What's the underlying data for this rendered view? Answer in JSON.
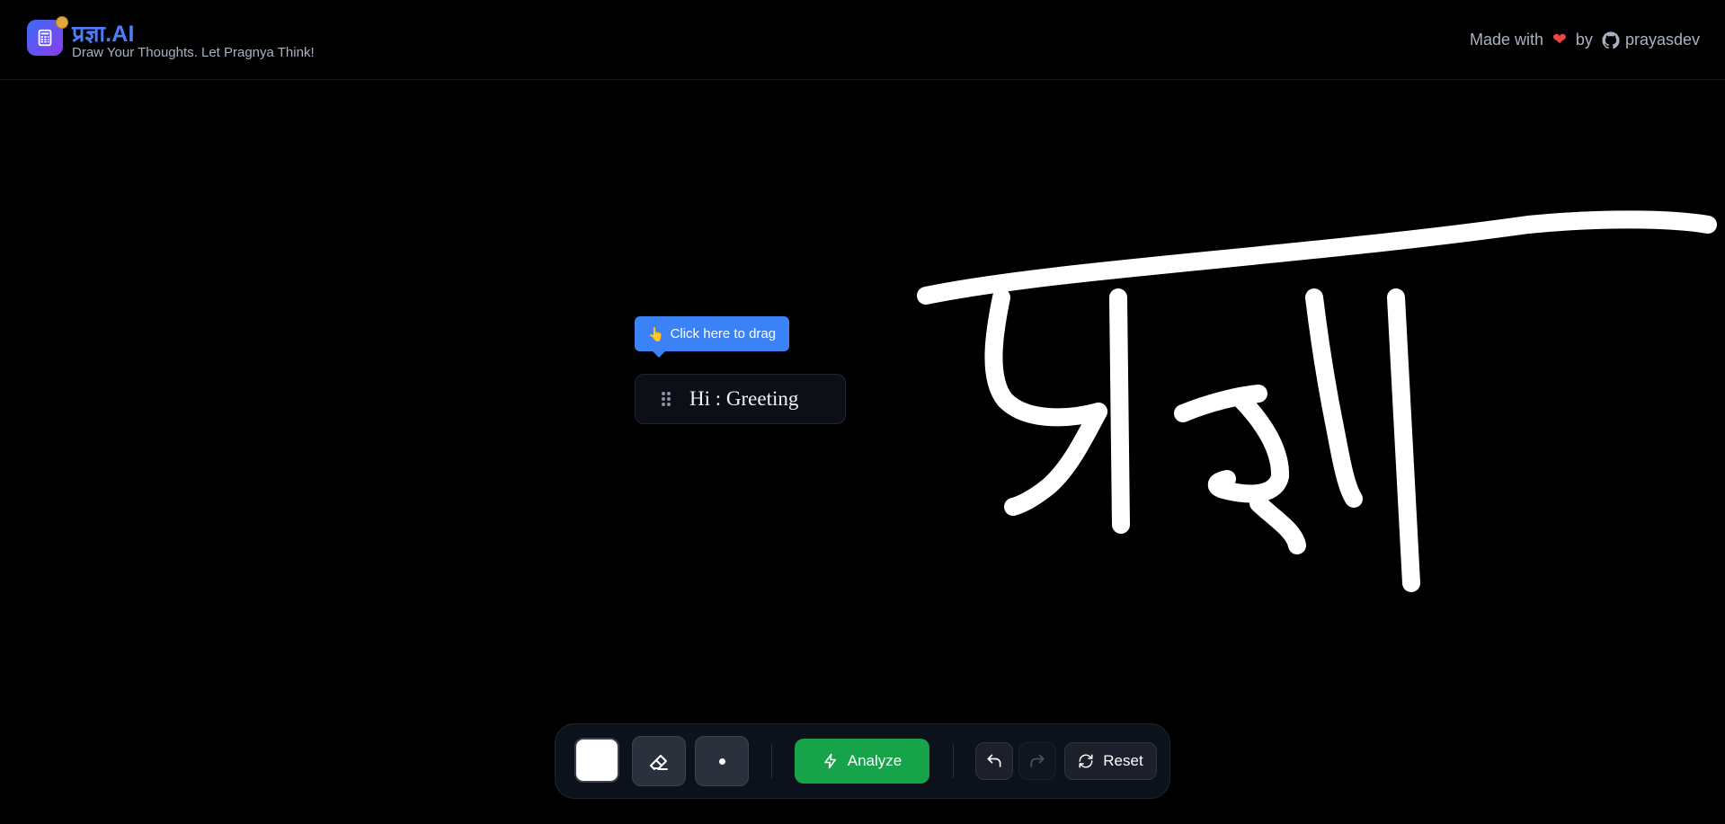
{
  "header": {
    "app_title": "प्रज्ञा.AI",
    "tagline": "Draw Your Thoughts. Let Pragnya Think!",
    "credits": {
      "made_with": "Made with",
      "by": "by",
      "author": "prayasdev"
    }
  },
  "canvas": {
    "drawing": "प्रज्ञा",
    "stroke_color": "#ffffff"
  },
  "result": {
    "drag_hint": "Click here to drag",
    "text": "Hi : Greeting"
  },
  "toolbar": {
    "selected_color": "#ffffff",
    "analyze_label": "Analyze",
    "reset_label": "Reset"
  },
  "colors": {
    "accent": "#4f7cf7",
    "analyze": "#16a34a",
    "tooltip": "#3b82f6",
    "heart": "#ef4444",
    "background": "#000000"
  }
}
